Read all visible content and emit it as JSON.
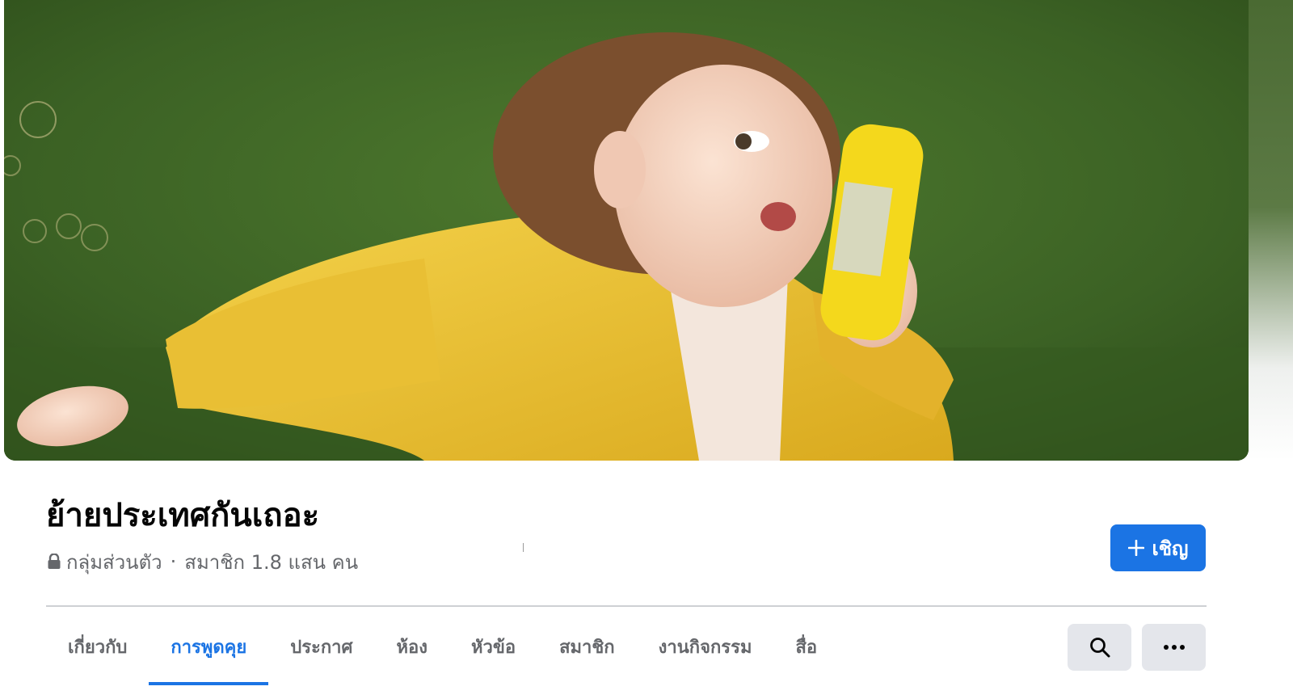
{
  "group": {
    "name": "ย้ายประเทศกันเถอะ",
    "privacy": "กลุ่มส่วนตัว",
    "members": "สมาชิก 1.8 แสน คน"
  },
  "actions": {
    "invite_label": "เชิญ"
  },
  "tabs": [
    {
      "label": "เกี่ยวกับ",
      "active": false
    },
    {
      "label": "การพูดคุย",
      "active": true
    },
    {
      "label": "ประกาศ",
      "active": false
    },
    {
      "label": "ห้อง",
      "active": false
    },
    {
      "label": "หัวข้อ",
      "active": false
    },
    {
      "label": "สมาชิก",
      "active": false
    },
    {
      "label": "งานกิจกรรม",
      "active": false
    },
    {
      "label": "สื่อ",
      "active": false
    }
  ],
  "icons": {
    "privacy": "lock-icon",
    "invite": "plus-icon",
    "search": "search-icon",
    "more": "more-horizontal-icon"
  },
  "colors": {
    "accent": "#1b74e4",
    "text_primary": "#050505",
    "text_secondary": "#65676b",
    "icon_button_bg": "#e4e6eb"
  }
}
